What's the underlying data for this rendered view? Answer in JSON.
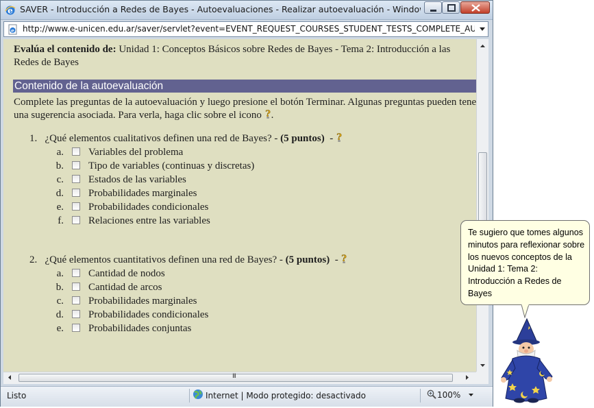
{
  "window": {
    "title": "SAVER - Introducción a Redes de Bayes - Autoevaluaciones - Realizar autoevaluación - Windows Internet Ex...",
    "url": "http://www.e-unicen.edu.ar/saver/servlet?event=EVENT_REQUEST_COURSES_STUDENT_TESTS_COMPLETE_AUTO_TEST&tes"
  },
  "page": {
    "eval_label": "Evalúa el contenido de:",
    "eval_value": "Unidad 1: Conceptos Básicos sobre Redes de Bayes - Tema 2: Introducción a las Redes de Bayes",
    "section_title": "Contenido de la autoevaluación",
    "instructions_line1": "Complete las preguntas de la autoevaluación y luego presione el botón Terminar. Algunas preguntas pueden tene",
    "instructions_line2": "una sugerencia asociada. Para verla, haga clic sobre el icono",
    "questions": [
      {
        "number": "1.",
        "text": "¿Qué elementos cualitativos definen una red de Bayes? -",
        "points": "(5 puntos)",
        "options": [
          {
            "letter": "a.",
            "label": "Variables del problema"
          },
          {
            "letter": "b.",
            "label": "Tipo de variables (continuas y discretas)"
          },
          {
            "letter": "c.",
            "label": "Estados de las variables"
          },
          {
            "letter": "d.",
            "label": "Probabilidades marginales"
          },
          {
            "letter": "e.",
            "label": "Probabilidades condicionales"
          },
          {
            "letter": "f.",
            "label": "Relaciones entre las variables"
          }
        ]
      },
      {
        "number": "2.",
        "text": "¿Qué elementos cuantitativos definen una red de Bayes? -",
        "points": "(5 puntos)",
        "options": [
          {
            "letter": "a.",
            "label": "Cantidad de nodos"
          },
          {
            "letter": "b.",
            "label": "Cantidad de arcos"
          },
          {
            "letter": "c.",
            "label": "Probabilidades marginales"
          },
          {
            "letter": "d.",
            "label": "Probabilidades condicionales"
          },
          {
            "letter": "e.",
            "label": "Probabilidades conjuntas"
          }
        ]
      }
    ]
  },
  "status": {
    "text": "Listo",
    "zone": "Internet | Modo protegido: desactivado",
    "zoom": "100%"
  },
  "assistant": {
    "message": "Te sugiero que tomes algunos minutos para reflexionar sobre los nuevos conceptos de la Unidad 1: Tema 2: Introducción a Redes de Bayes"
  },
  "colors": {
    "content_bg": "#dfdfc1",
    "section_header_bg": "#626290",
    "bubble_bg": "#ffffe3"
  },
  "icons": [
    "ie-icon",
    "page-icon",
    "hint-icon",
    "globe-icon",
    "zoom-icon",
    "wizard-icon"
  ]
}
